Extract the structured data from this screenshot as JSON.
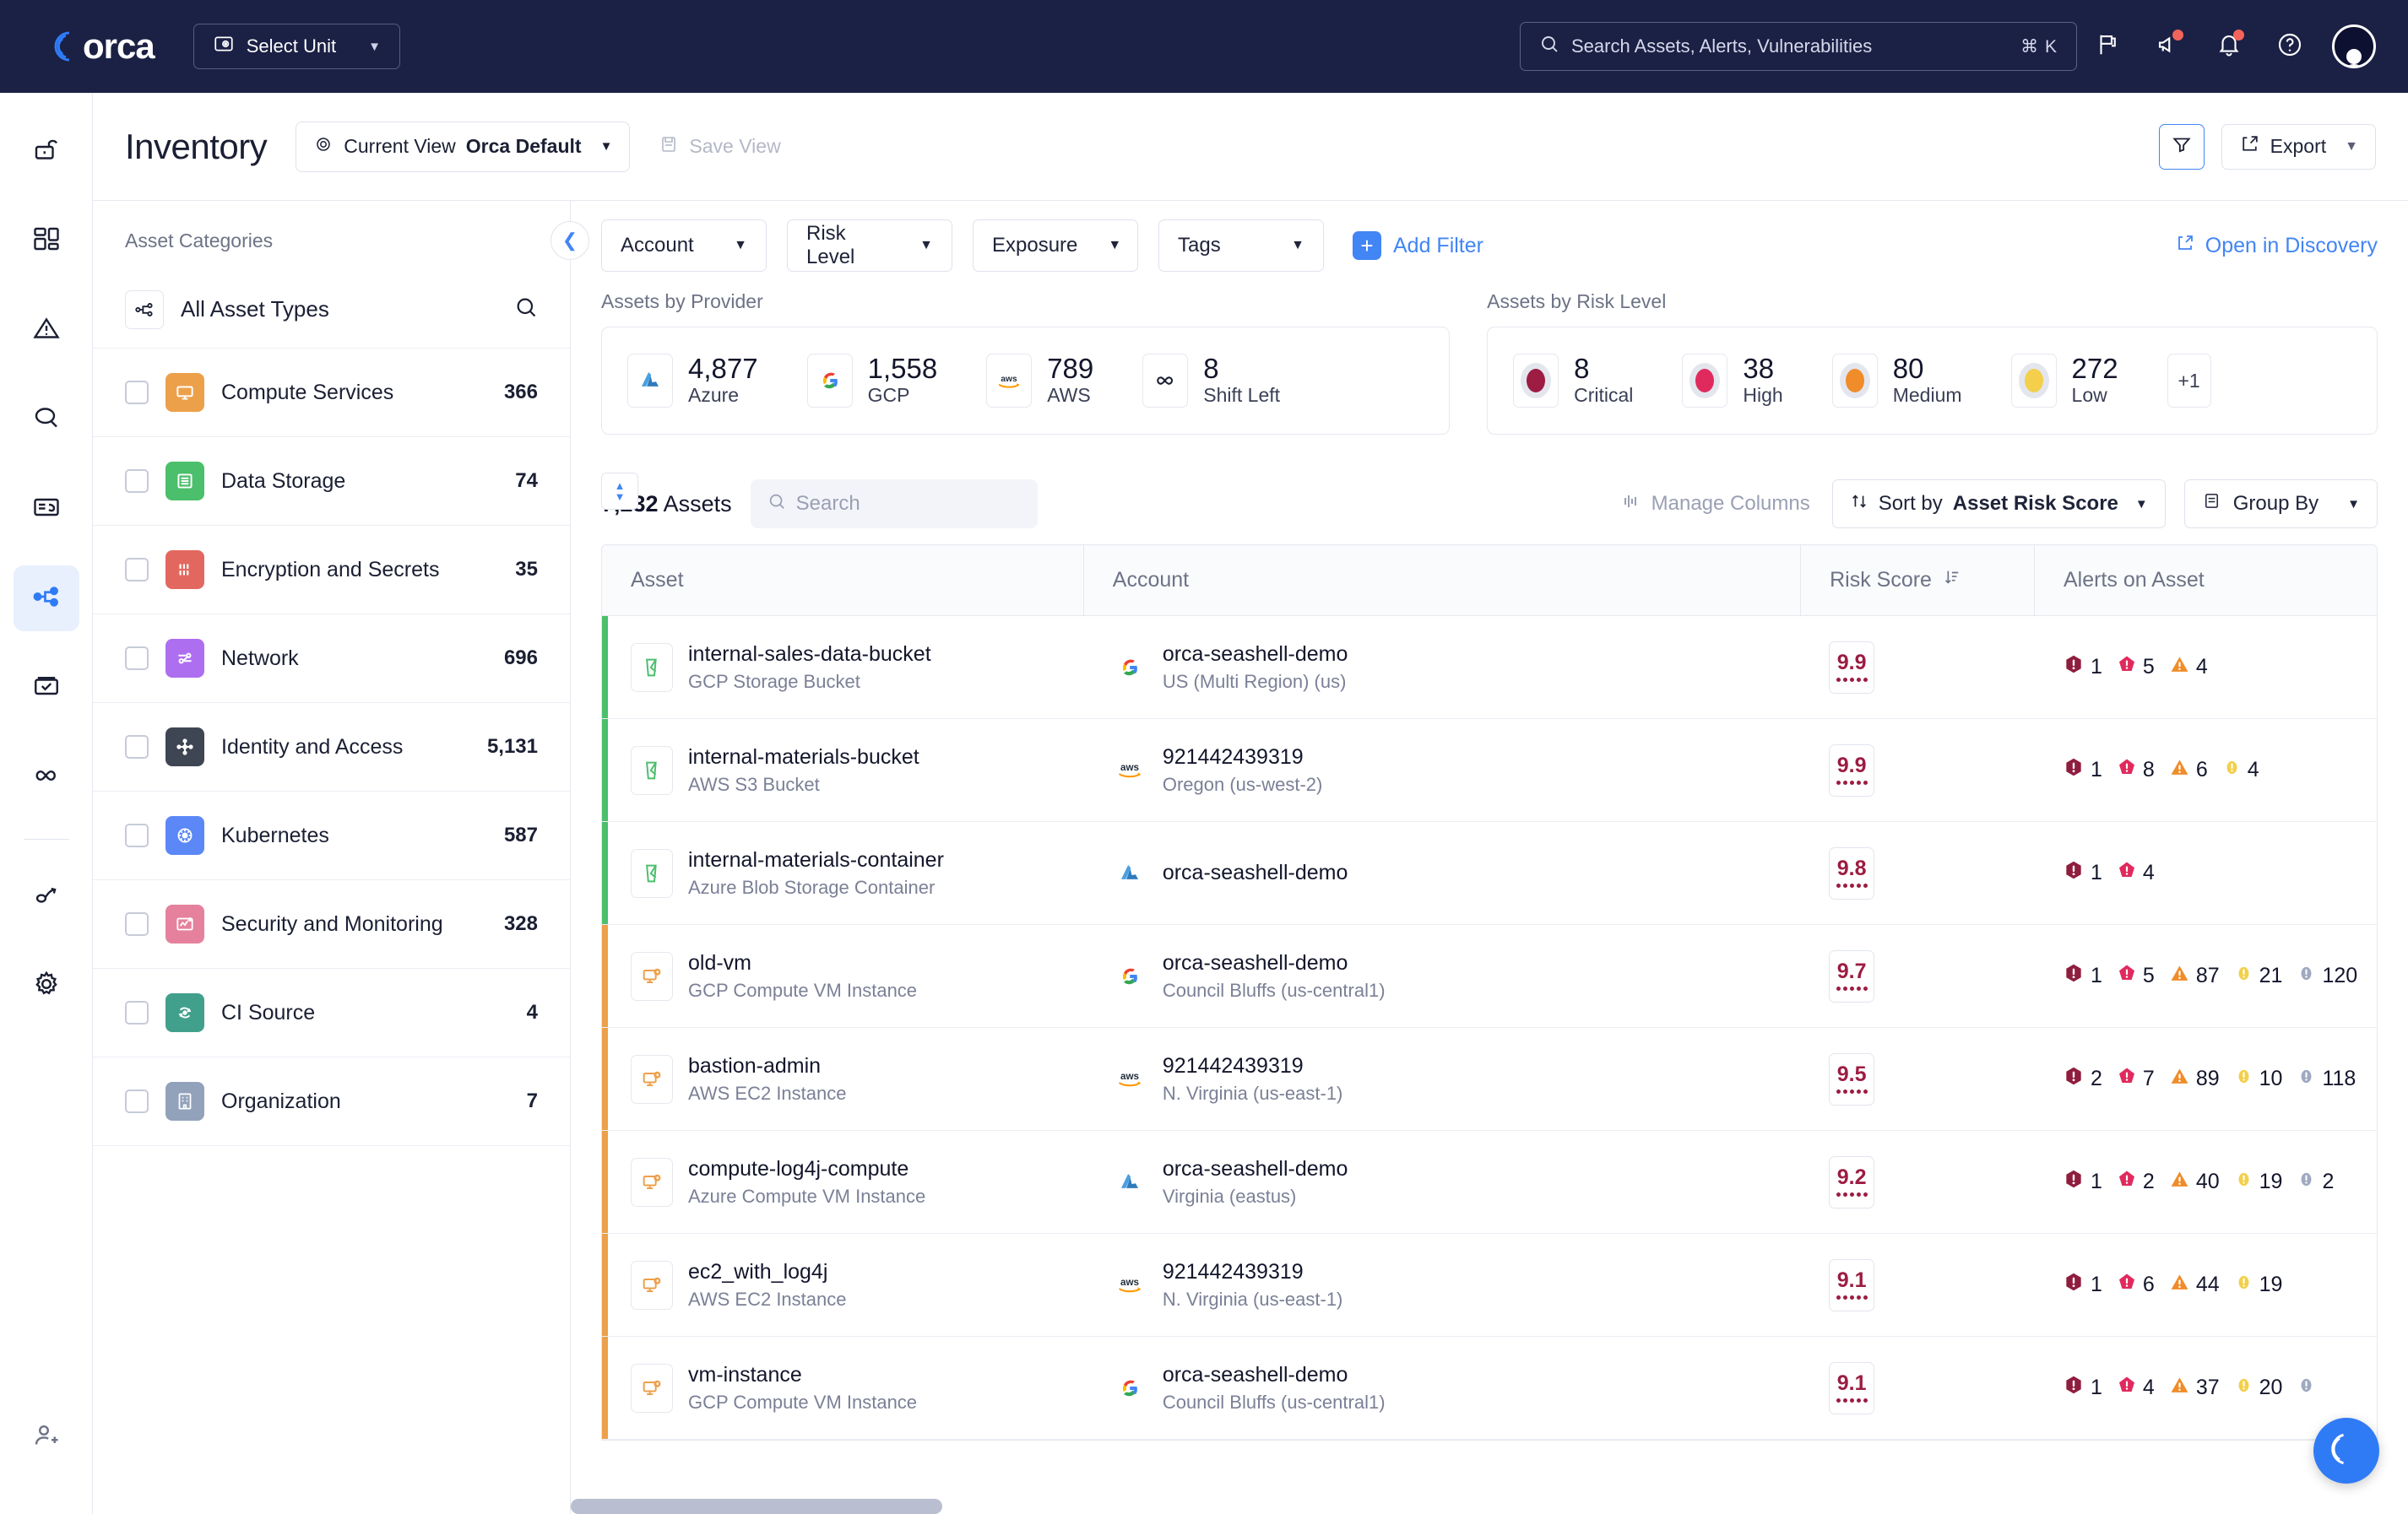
{
  "topbar": {
    "brand": "orca",
    "unit_button": "Select Unit",
    "search_placeholder": "Search Assets, Alerts, Vulnerabilities",
    "search_shortcut": "⌘ K",
    "icons": [
      "flag-icon",
      "announcement-icon",
      "bell-icon",
      "help-icon",
      "avatar"
    ]
  },
  "rail": {
    "items": [
      {
        "name": "unlock-icon",
        "active": false
      },
      {
        "name": "dashboard-icon",
        "active": false
      },
      {
        "name": "alerts-warning-icon",
        "active": false
      },
      {
        "name": "search-icon",
        "active": false
      },
      {
        "name": "reports-icon",
        "active": false
      },
      {
        "name": "inventory-nodes-icon",
        "active": true
      },
      {
        "name": "compliance-checkbox-icon",
        "active": false
      },
      {
        "name": "shift-left-infinity-icon",
        "active": false
      },
      {
        "name": "integrations-icon",
        "active": false
      },
      {
        "name": "settings-gear-icon",
        "active": false
      }
    ],
    "bottom_item": "user-management-icon"
  },
  "header": {
    "title": "Inventory",
    "current_view_label": "Current View",
    "current_view_value": "Orca Default",
    "save_view": "Save View",
    "export": "Export"
  },
  "sidebar": {
    "title": "Asset Categories",
    "all_asset_types": "All Asset Types",
    "items": [
      {
        "label": "Compute Services",
        "count": "366",
        "color": "#eda04a",
        "icon": "monitor-icon"
      },
      {
        "label": "Data Storage",
        "count": "74",
        "color": "#4bbf6b",
        "icon": "database-icon"
      },
      {
        "label": "Encryption and Secrets",
        "count": "35",
        "color": "#e2685f",
        "icon": "binary-icon"
      },
      {
        "label": "Network",
        "count": "696",
        "color": "#ae6ef0",
        "icon": "network-icon"
      },
      {
        "label": "Identity and Access",
        "count": "5,131",
        "color": "#3e4654",
        "icon": "identity-icon"
      },
      {
        "label": "Kubernetes",
        "count": "587",
        "color": "#5b87f7",
        "icon": "kubernetes-icon"
      },
      {
        "label": "Security and Monitoring",
        "count": "328",
        "color": "#e5819d",
        "icon": "monitoring-icon"
      },
      {
        "label": "CI Source",
        "count": "4",
        "color": "#41a08c",
        "icon": "ci-source-icon"
      },
      {
        "label": "Organization",
        "count": "7",
        "color": "#93a2bb",
        "icon": "organization-icon"
      }
    ]
  },
  "filters": {
    "account": "Account",
    "risk_level": "Risk Level",
    "exposure": "Exposure",
    "tags": "Tags",
    "add_filter": "Add Filter",
    "open_in_discovery": "Open in Discovery"
  },
  "stats": {
    "provider_title": "Assets by Provider",
    "providers": [
      {
        "value": "4,877",
        "label": "Azure",
        "icon": "azure-icon"
      },
      {
        "value": "1,558",
        "label": "GCP",
        "icon": "gcp-icon"
      },
      {
        "value": "789",
        "label": "AWS",
        "icon": "aws-icon"
      },
      {
        "value": "8",
        "label": "Shift Left",
        "icon": "infinity-icon"
      }
    ],
    "risk_title": "Assets by Risk Level",
    "risk_levels": [
      {
        "value": "8",
        "label": "Critical",
        "color": "#9c1c42"
      },
      {
        "value": "38",
        "label": "High",
        "color": "#e02a5e"
      },
      {
        "value": "80",
        "label": "Medium",
        "color": "#f08c29"
      },
      {
        "value": "272",
        "label": "Low",
        "color": "#f3cf4b"
      }
    ],
    "risk_more": "+1"
  },
  "toolbar": {
    "count": "7,232",
    "count_suffix": " Assets",
    "search_placeholder": "Search",
    "manage_columns": "Manage Columns",
    "sort_by_label": "Sort by",
    "sort_by_value": "Asset Risk Score",
    "group_by": "Group By"
  },
  "table": {
    "columns": [
      "Asset",
      "Account",
      "Risk Score",
      "Alerts on Asset"
    ],
    "rows": [
      {
        "asset": "internal-sales-data-bucket",
        "asset_type": "GCP Storage Bucket",
        "asset_icon": "bucket-icon",
        "account": "orca-seashell-demo",
        "region": "US (Multi Region) (us)",
        "provider": "gcp",
        "score": "9.9",
        "stripe": "#4bbf6b",
        "alerts": [
          {
            "sev": "critical",
            "n": "1"
          },
          {
            "sev": "high",
            "n": "5"
          },
          {
            "sev": "medium",
            "n": "4"
          }
        ]
      },
      {
        "asset": "internal-materials-bucket",
        "asset_type": "AWS S3 Bucket",
        "asset_icon": "bucket-icon",
        "account": "921442439319",
        "region": "Oregon (us-west-2)",
        "provider": "aws",
        "score": "9.9",
        "stripe": "#4bbf6b",
        "alerts": [
          {
            "sev": "critical",
            "n": "1"
          },
          {
            "sev": "high",
            "n": "8"
          },
          {
            "sev": "medium",
            "n": "6"
          },
          {
            "sev": "low",
            "n": "4"
          }
        ]
      },
      {
        "asset": "internal-materials-container",
        "asset_type": "Azure Blob Storage Container",
        "asset_icon": "bucket-icon",
        "account": "orca-seashell-demo",
        "region": "",
        "provider": "azure",
        "score": "9.8",
        "stripe": "#4bbf6b",
        "alerts": [
          {
            "sev": "critical",
            "n": "1"
          },
          {
            "sev": "high",
            "n": "4"
          }
        ]
      },
      {
        "asset": "old-vm",
        "asset_type": "GCP Compute VM Instance",
        "asset_icon": "vm-icon",
        "account": "orca-seashell-demo",
        "region": "Council Bluffs (us-central1)",
        "provider": "gcp",
        "score": "9.7",
        "stripe": "#eda04a",
        "alerts": [
          {
            "sev": "critical",
            "n": "1"
          },
          {
            "sev": "high",
            "n": "5"
          },
          {
            "sev": "medium",
            "n": "87"
          },
          {
            "sev": "low",
            "n": "21"
          },
          {
            "sev": "info",
            "n": "120"
          }
        ]
      },
      {
        "asset": "bastion-admin",
        "asset_type": "AWS EC2 Instance",
        "asset_icon": "vm-icon",
        "account": "921442439319",
        "region": "N. Virginia (us-east-1)",
        "provider": "aws",
        "score": "9.5",
        "stripe": "#eda04a",
        "alerts": [
          {
            "sev": "critical",
            "n": "2"
          },
          {
            "sev": "high",
            "n": "7"
          },
          {
            "sev": "medium",
            "n": "89"
          },
          {
            "sev": "low",
            "n": "10"
          },
          {
            "sev": "info",
            "n": "118"
          }
        ]
      },
      {
        "asset": "compute-log4j-compute",
        "asset_type": "Azure Compute VM Instance",
        "asset_icon": "vm-icon",
        "account": "orca-seashell-demo",
        "region": "Virginia (eastus)",
        "provider": "azure",
        "score": "9.2",
        "stripe": "#eda04a",
        "alerts": [
          {
            "sev": "critical",
            "n": "1"
          },
          {
            "sev": "high",
            "n": "2"
          },
          {
            "sev": "medium",
            "n": "40"
          },
          {
            "sev": "low",
            "n": "19"
          },
          {
            "sev": "info",
            "n": "2"
          }
        ]
      },
      {
        "asset": "ec2_with_log4j",
        "asset_type": "AWS EC2 Instance",
        "asset_icon": "vm-icon",
        "account": "921442439319",
        "region": "N. Virginia (us-east-1)",
        "provider": "aws",
        "score": "9.1",
        "stripe": "#eda04a",
        "alerts": [
          {
            "sev": "critical",
            "n": "1"
          },
          {
            "sev": "high",
            "n": "6"
          },
          {
            "sev": "medium",
            "n": "44"
          },
          {
            "sev": "low",
            "n": "19"
          }
        ]
      },
      {
        "asset": "vm-instance",
        "asset_type": "GCP Compute VM Instance",
        "asset_icon": "vm-icon",
        "account": "orca-seashell-demo",
        "region": "Council Bluffs (us-central1)",
        "provider": "gcp",
        "score": "9.1",
        "stripe": "#eda04a",
        "alerts": [
          {
            "sev": "critical",
            "n": "1"
          },
          {
            "sev": "high",
            "n": "4"
          },
          {
            "sev": "medium",
            "n": "37"
          },
          {
            "sev": "low",
            "n": "20"
          },
          {
            "sev": "info",
            "n": ""
          }
        ]
      }
    ]
  },
  "severity_colors": {
    "critical": "#8f1d3f",
    "high": "#e02a5e",
    "medium": "#f08c29",
    "low": "#f3cf4b",
    "info": "#9fa9c0"
  }
}
